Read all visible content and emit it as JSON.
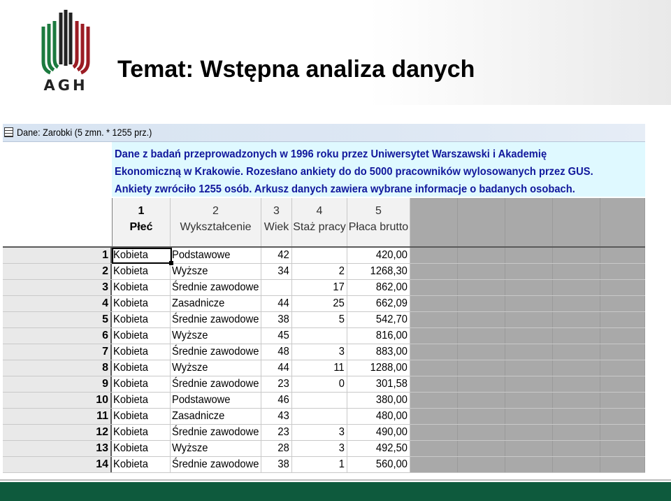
{
  "logo": {
    "text": "AGH",
    "colors": {
      "green": "#1c7a3f",
      "red": "#9b1c24",
      "black": "#222222"
    }
  },
  "slide": {
    "title": "Temat: Wstępna analiza danych"
  },
  "window": {
    "title": "Dane: Zarobki (5 zmn. * 1255 prz.)",
    "icon": "spreadsheet-icon"
  },
  "info": {
    "lines": [
      "Dane z badań przeprowadzonych w 1996 roku przez Uniwersytet Warszawski i Akademię",
      "Ekonomiczną w Krakowie. Rozesłano ankiety do do 5000 pracowników wylosowanych przez GUS.",
      "Ankiety zwróciło 1255 osób. Arkusz danych zawiera wybrane informacje o badanych osobach."
    ],
    "colors": {
      "background": "#dff9ff",
      "text": "#11189c"
    }
  },
  "columns": [
    {
      "num": "1",
      "name": "Płeć"
    },
    {
      "num": "2",
      "name": "Wykształcenie"
    },
    {
      "num": "3",
      "name": "Wiek"
    },
    {
      "num": "4",
      "name": "Staż pracy"
    },
    {
      "num": "5",
      "name": "Płaca brutto"
    }
  ],
  "rows": [
    {
      "n": "1",
      "plec": "Kobieta",
      "wyk": "Podstawowe",
      "wiek": "42",
      "staz": "",
      "placa": "420,00"
    },
    {
      "n": "2",
      "plec": "Kobieta",
      "wyk": "Wyższe",
      "wiek": "34",
      "staz": "2",
      "placa": "1268,30"
    },
    {
      "n": "3",
      "plec": "Kobieta",
      "wyk": "Średnie zawodowe",
      "wiek": "",
      "staz": "17",
      "placa": "862,00"
    },
    {
      "n": "4",
      "plec": "Kobieta",
      "wyk": "Zasadnicze",
      "wiek": "44",
      "staz": "25",
      "placa": "662,09"
    },
    {
      "n": "5",
      "plec": "Kobieta",
      "wyk": "Średnie zawodowe",
      "wiek": "38",
      "staz": "5",
      "placa": "542,70"
    },
    {
      "n": "6",
      "plec": "Kobieta",
      "wyk": "Wyższe",
      "wiek": "45",
      "staz": "",
      "placa": "816,00"
    },
    {
      "n": "7",
      "plec": "Kobieta",
      "wyk": "Średnie zawodowe",
      "wiek": "48",
      "staz": "3",
      "placa": "883,00"
    },
    {
      "n": "8",
      "plec": "Kobieta",
      "wyk": "Wyższe",
      "wiek": "44",
      "staz": "11",
      "placa": "1288,00"
    },
    {
      "n": "9",
      "plec": "Kobieta",
      "wyk": "Średnie zawodowe",
      "wiek": "23",
      "staz": "0",
      "placa": "301,58"
    },
    {
      "n": "10",
      "plec": "Kobieta",
      "wyk": "Podstawowe",
      "wiek": "46",
      "staz": "",
      "placa": "380,00"
    },
    {
      "n": "11",
      "plec": "Kobieta",
      "wyk": "Zasadnicze",
      "wiek": "43",
      "staz": "",
      "placa": "480,00"
    },
    {
      "n": "12",
      "plec": "Kobieta",
      "wyk": "Średnie zawodowe",
      "wiek": "23",
      "staz": "3",
      "placa": "490,00"
    },
    {
      "n": "13",
      "plec": "Kobieta",
      "wyk": "Wyższe",
      "wiek": "28",
      "staz": "3",
      "placa": "492,50"
    },
    {
      "n": "14",
      "plec": "Kobieta",
      "wyk": "Średnie zawodowe",
      "wiek": "38",
      "staz": "1",
      "placa": "560,00"
    }
  ],
  "colors": {
    "grid_empty": "#a9a9a9",
    "row_header": "#e9e9e9",
    "footer": "#0e5a3d"
  }
}
